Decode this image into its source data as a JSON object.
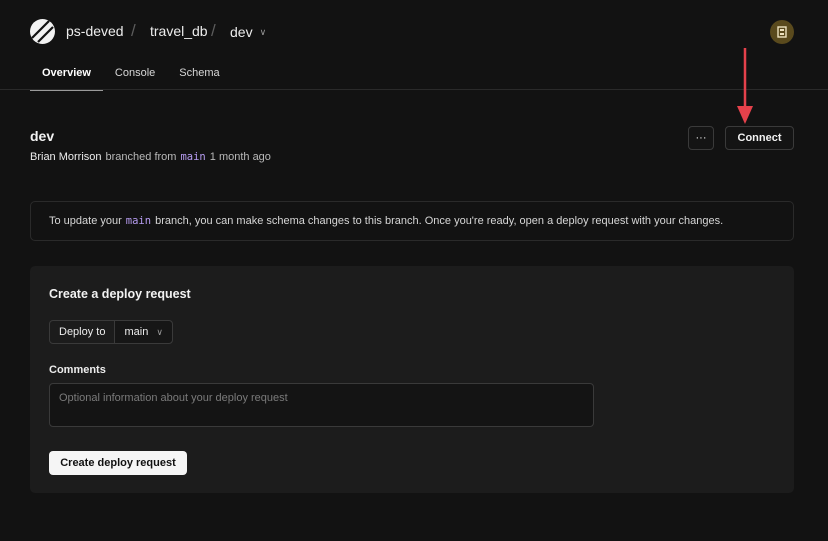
{
  "breadcrumb": {
    "org": "ps-deved",
    "separator": "/",
    "database": "travel_db",
    "branch": "dev"
  },
  "tabs": [
    {
      "label": "Overview",
      "active": true
    },
    {
      "label": "Console",
      "active": false
    },
    {
      "label": "Schema",
      "active": false
    }
  ],
  "branch": {
    "name": "dev",
    "author": "Brian Morrison",
    "action_text": "branched from",
    "parent": "main",
    "age": "1 month ago"
  },
  "header_actions": {
    "more_label": "···",
    "connect_label": "Connect"
  },
  "info_banner": {
    "prefix": "To update your",
    "branch": "main",
    "suffix": "branch, you can make schema changes to this branch. Once you're ready, open a deploy request with your changes."
  },
  "deploy_request": {
    "title": "Create a deploy request",
    "deploy_to_label": "Deploy to",
    "target_branch": "main",
    "comments_label": "Comments",
    "comments_placeholder": "Optional information about your deploy request",
    "comments_value": "",
    "submit_label": "Create deploy request"
  },
  "icons": {
    "logo": "planetscale-logo-icon",
    "avatar": "user-avatar-icon",
    "annotation": "red-arrow-icon"
  },
  "colors": {
    "background": "#121212",
    "card": "#1c1c1c",
    "code_accent": "#b69cf0",
    "arrow": "#e5414b",
    "avatar": "#5a4a1d"
  }
}
